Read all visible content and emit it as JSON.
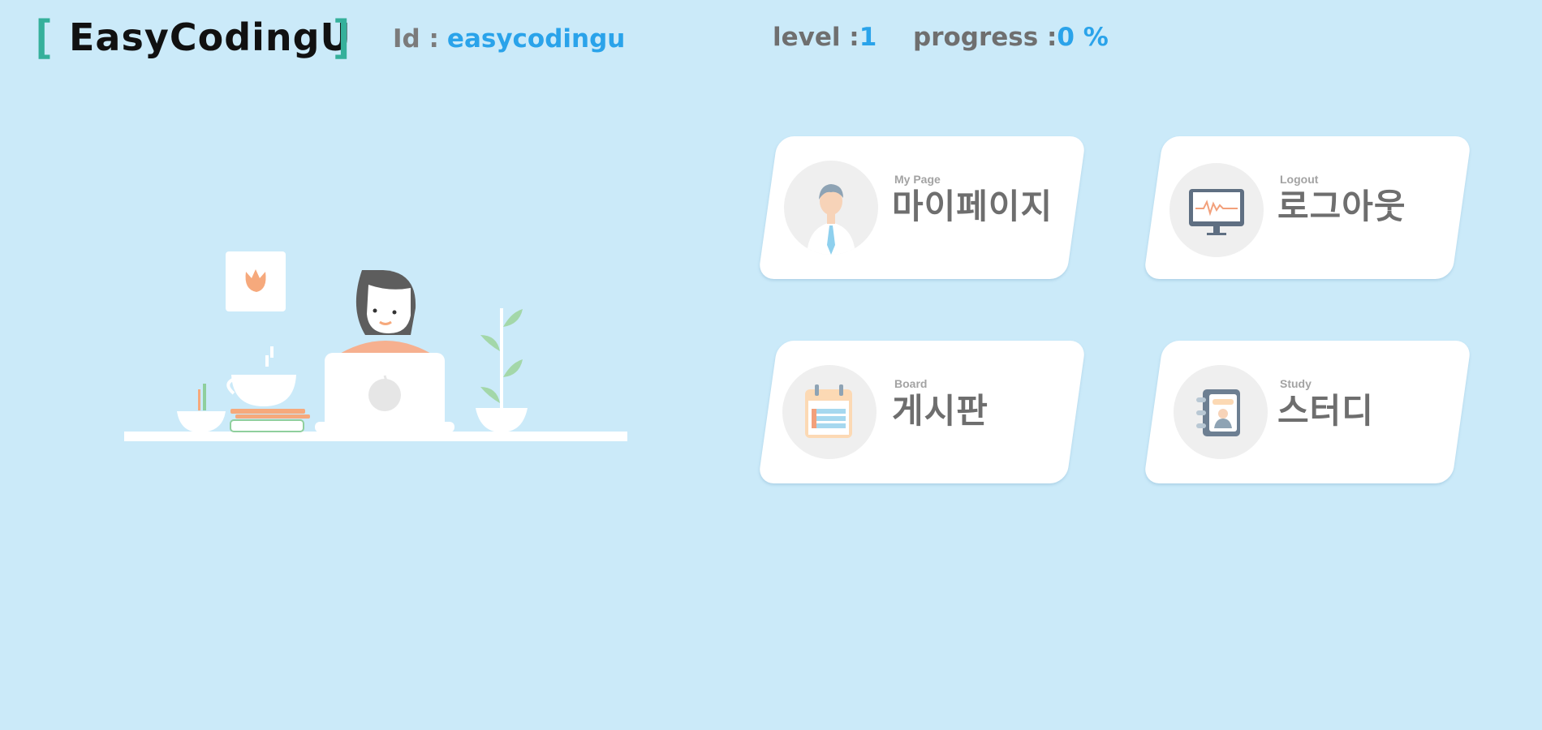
{
  "header": {
    "bracket_open": "[",
    "brand": "EasyCodingU",
    "bracket_close": "]",
    "id_label": "Id :",
    "id_value": "easycodingu",
    "level_label": "level :",
    "level_value": "1",
    "progress_label": "progress :",
    "progress_value": "0 %"
  },
  "menu": [
    {
      "sub": "My Page",
      "title": "마이페이지",
      "icon": "person-icon"
    },
    {
      "sub": "Logout",
      "title": "로그아웃",
      "icon": "monitor-icon"
    },
    {
      "sub": "Board",
      "title": "게시판",
      "icon": "calendar-icon"
    },
    {
      "sub": "Study",
      "title": "스터디",
      "icon": "notebook-icon"
    }
  ],
  "colors": {
    "background": "#cbeaf9",
    "bracket": "#35b09b",
    "accent": "#2aa3ea",
    "card": "#ffffff"
  }
}
